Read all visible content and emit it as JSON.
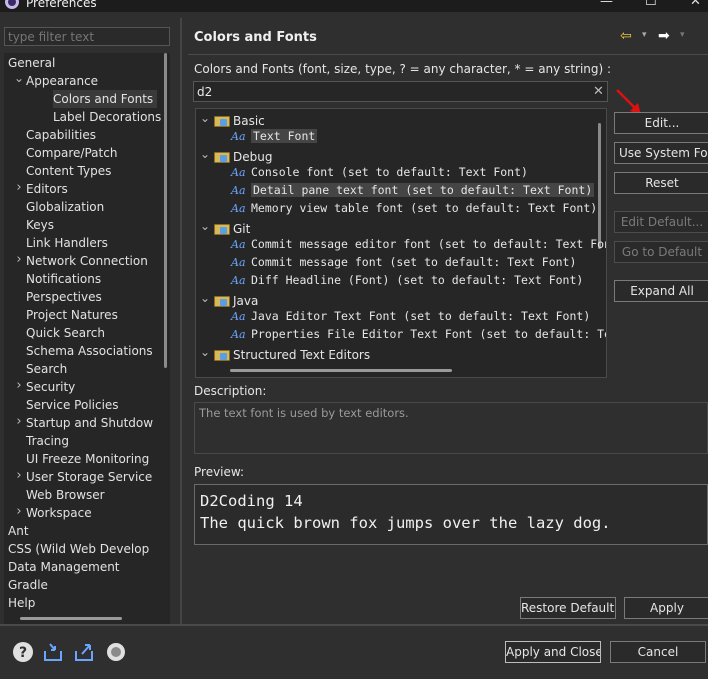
{
  "window": {
    "title": "Preferences",
    "controls": {
      "minimize": "—",
      "maximize": "☐",
      "close": "✕"
    }
  },
  "filter": {
    "placeholder": "type filter text",
    "value": ""
  },
  "nav_tree": [
    {
      "label": "General",
      "level": 0,
      "toggle": "down"
    },
    {
      "label": "Appearance",
      "level": 1,
      "toggle": "down"
    },
    {
      "label": "Colors and Fonts",
      "level": 2,
      "toggle": "",
      "selected": true
    },
    {
      "label": "Label Decorations",
      "level": 2,
      "toggle": ""
    },
    {
      "label": "Capabilities",
      "level": 1,
      "toggle": ""
    },
    {
      "label": "Compare/Patch",
      "level": 1,
      "toggle": ""
    },
    {
      "label": "Content Types",
      "level": 1,
      "toggle": ""
    },
    {
      "label": "Editors",
      "level": 1,
      "toggle": "right"
    },
    {
      "label": "Globalization",
      "level": 1,
      "toggle": ""
    },
    {
      "label": "Keys",
      "level": 1,
      "toggle": ""
    },
    {
      "label": "Link Handlers",
      "level": 1,
      "toggle": ""
    },
    {
      "label": "Network Connection",
      "level": 1,
      "toggle": "right"
    },
    {
      "label": "Notifications",
      "level": 1,
      "toggle": ""
    },
    {
      "label": "Perspectives",
      "level": 1,
      "toggle": ""
    },
    {
      "label": "Project Natures",
      "level": 1,
      "toggle": ""
    },
    {
      "label": "Quick Search",
      "level": 1,
      "toggle": ""
    },
    {
      "label": "Schema Associations",
      "level": 1,
      "toggle": ""
    },
    {
      "label": "Search",
      "level": 1,
      "toggle": ""
    },
    {
      "label": "Security",
      "level": 1,
      "toggle": "right"
    },
    {
      "label": "Service Policies",
      "level": 1,
      "toggle": ""
    },
    {
      "label": "Startup and Shutdow",
      "level": 1,
      "toggle": "right"
    },
    {
      "label": "Tracing",
      "level": 1,
      "toggle": ""
    },
    {
      "label": "UI Freeze Monitoring",
      "level": 1,
      "toggle": ""
    },
    {
      "label": "User Storage Service",
      "level": 1,
      "toggle": "right"
    },
    {
      "label": "Web Browser",
      "level": 1,
      "toggle": ""
    },
    {
      "label": "Workspace",
      "level": 1,
      "toggle": "right"
    },
    {
      "label": "Ant",
      "level": 0,
      "toggle": "right"
    },
    {
      "label": "CSS (Wild Web Develop",
      "level": 0,
      "toggle": "right"
    },
    {
      "label": "Data Management",
      "level": 0,
      "toggle": "right"
    },
    {
      "label": "Gradle",
      "level": 0,
      "toggle": "right"
    },
    {
      "label": "Help",
      "level": 0,
      "toggle": "right"
    }
  ],
  "page": {
    "title": "Colors and Fonts",
    "description": "Colors and Fonts (font, size, type, ? = any character, * = any string) :",
    "search_value": "d2",
    "clear_icon": "✕"
  },
  "font_tree": [
    {
      "type": "cat",
      "label": "Basic"
    },
    {
      "type": "item",
      "label": "Text Font",
      "highlight": true
    },
    {
      "type": "cat",
      "label": "Debug"
    },
    {
      "type": "item",
      "label": "Console font (set to default: Text Font)"
    },
    {
      "type": "item",
      "label": "Detail pane text font (set to default: Text Font)",
      "highlight": true
    },
    {
      "type": "item",
      "label": "Memory view table font (set to default: Text Font)"
    },
    {
      "type": "cat",
      "label": "Git"
    },
    {
      "type": "item",
      "label": "Commit message editor font (set to default: Text Font)"
    },
    {
      "type": "item",
      "label": "Commit message font (set to default: Text Font)"
    },
    {
      "type": "item",
      "label": "Diff Headline (Font) (set to default: Text Font)"
    },
    {
      "type": "cat",
      "label": "Java"
    },
    {
      "type": "item",
      "label": "Java Editor Text Font (set to default: Text Font)"
    },
    {
      "type": "item",
      "label": "Properties File Editor Text Font (set to default: Text Fo"
    },
    {
      "type": "cat",
      "label": "Structured Text Editors"
    }
  ],
  "buttons": {
    "edit": "Edit...",
    "use_system_font": "Use System Font",
    "reset": "Reset",
    "edit_default": "Edit Default...",
    "go_to_default": "Go to Default",
    "expand_all": "Expand All",
    "restore_defaults": "Restore Defaults",
    "apply": "Apply",
    "apply_and_close": "Apply and Close",
    "cancel": "Cancel"
  },
  "description_section": {
    "label": "Description:",
    "text": "The text font is used by text editors."
  },
  "preview_section": {
    "label": "Preview:",
    "line1": "D2Coding 14",
    "line2": "The quick brown fox jumps over the lazy dog."
  },
  "icons": {
    "nav_back": "⇦",
    "nav_forward": "➡",
    "dropdown": "▾",
    "tree_expanded": "⌄",
    "tree_collapsed": "›",
    "aa": "Aa",
    "help": "?"
  },
  "colors": {
    "annotation_arrow": "#e01010",
    "nav_back_color": "#f2c744",
    "link_icon_color": "#6aa6ff"
  }
}
